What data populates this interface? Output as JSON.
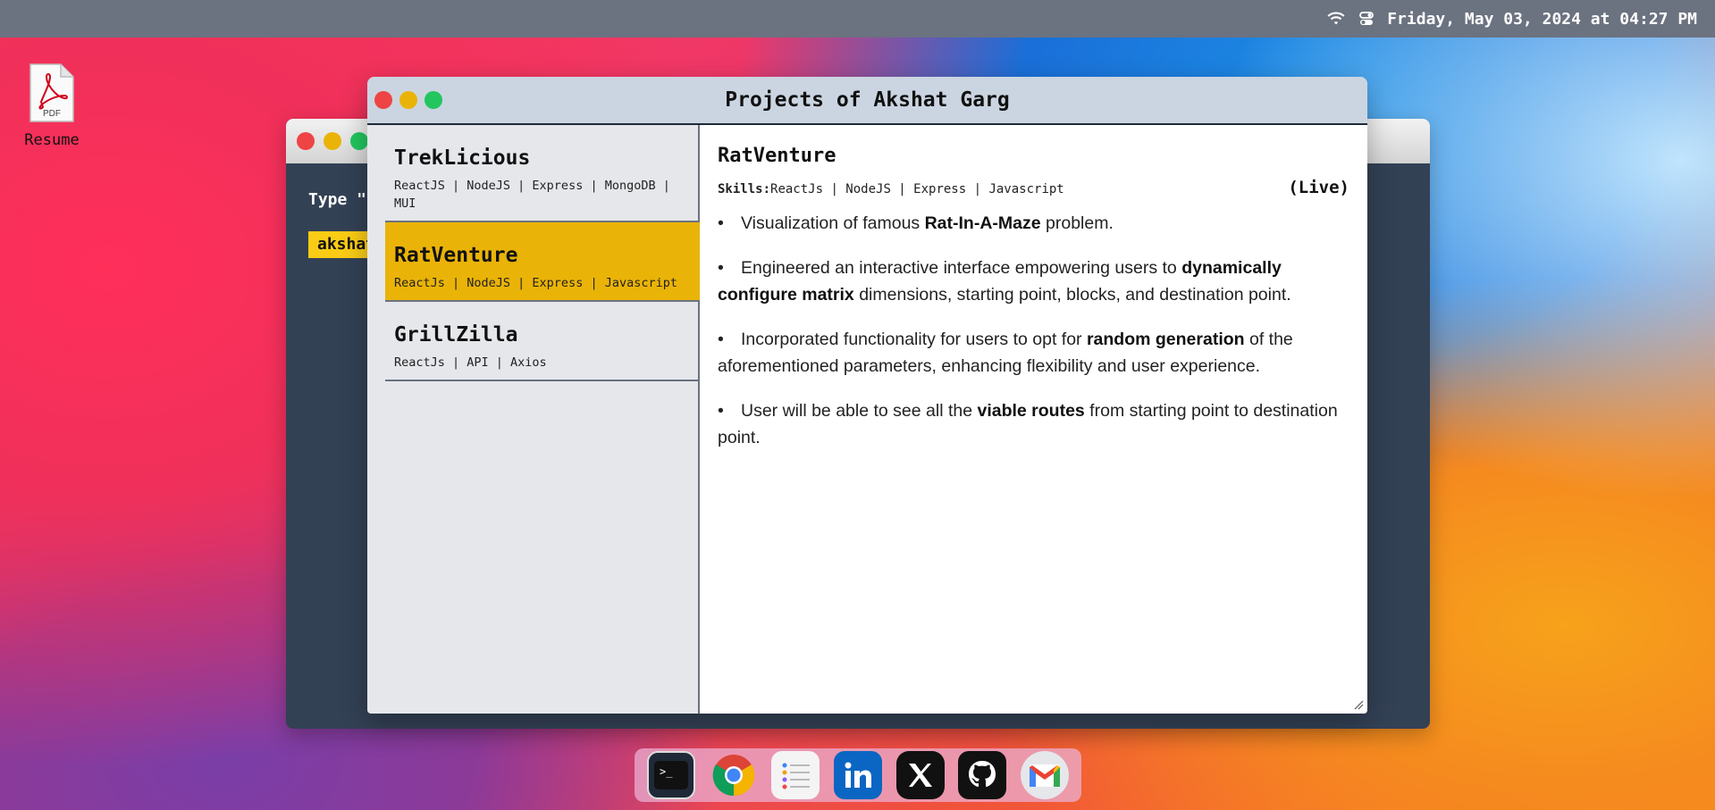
{
  "menubar": {
    "datetime": "Friday, May 03, 2024 at 04:27 PM",
    "icons": [
      "wifi-icon",
      "control-center-icon"
    ]
  },
  "desktop": {
    "icons": [
      {
        "label": "Resume",
        "icon": "pdf-file-icon",
        "badge": "PDF"
      }
    ]
  },
  "terminal_window": {
    "line": "Type \"",
    "prompt": "akshat"
  },
  "projects_window": {
    "title": "Projects of Akshat Garg",
    "projects": [
      {
        "name": "TrekLicious",
        "tags": "ReactJS | NodeJS | Express | MongoDB | MUI"
      },
      {
        "name": "RatVenture",
        "tags": "ReactJs | NodeJS | Express | Javascript"
      },
      {
        "name": "GrillZilla",
        "tags": "ReactJs | API | Axios"
      }
    ],
    "selected_index": 1,
    "detail": {
      "title": "RatVenture",
      "skills_label": "Skills:",
      "skills": "ReactJs | NodeJS | Express | Javascript",
      "status": "(Live)",
      "bullets": [
        {
          "pre": "Visualization of famous ",
          "bold": "Rat-In-A-Maze",
          "post": " problem."
        },
        {
          "pre": "Engineered an interactive interface empowering users to ",
          "bold": "dynamically configure matrix",
          "post": " dimensions, starting point, blocks, and destination point."
        },
        {
          "pre": "Incorporated functionality for users to opt for ",
          "bold": "random generation",
          "post": " of the aforementioned parameters, enhancing flexibility and user experience."
        },
        {
          "pre": "User will be able to see all the ",
          "bold": "viable routes",
          "post": " from starting point to destination point."
        }
      ]
    }
  },
  "dock": {
    "items": [
      "terminal-icon",
      "chrome-icon",
      "notes-list-icon",
      "linkedin-icon",
      "x-twitter-icon",
      "github-icon",
      "gmail-icon"
    ]
  },
  "colors": {
    "menubar": "#6b7280",
    "highlight": "#eab308",
    "terminal_bg": "#334155",
    "titlebar": "#cbd5e1"
  }
}
